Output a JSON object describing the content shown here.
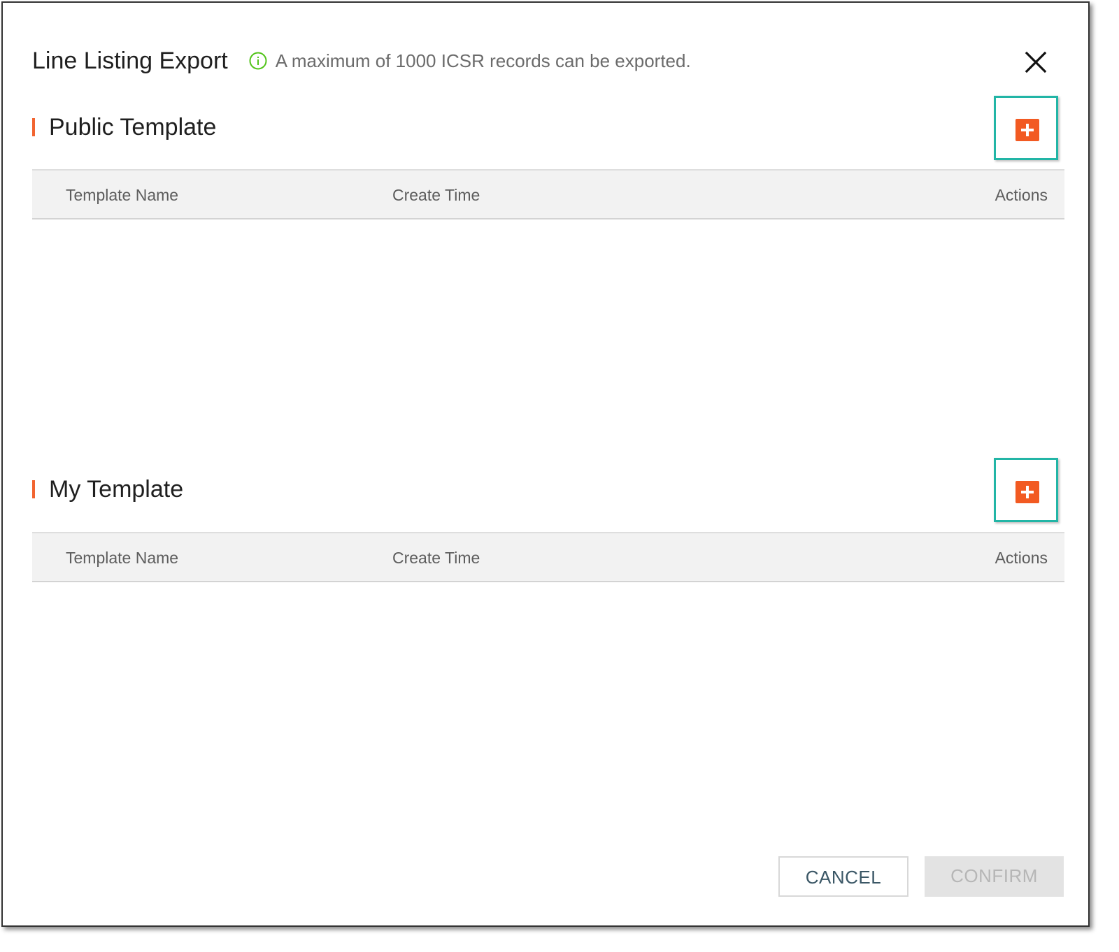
{
  "dialog": {
    "title": "Line Listing Export",
    "notice": "A maximum of 1000 ICSR records can be exported.",
    "notice_icon": "info-circle-icon",
    "close_icon": "close-icon"
  },
  "sections": [
    {
      "title": "Public Template",
      "add_icon": "plus-icon",
      "columns": [
        "Template Name",
        "Create Time",
        "Actions"
      ],
      "rows": []
    },
    {
      "title": "My Template",
      "add_icon": "plus-icon",
      "columns": [
        "Template Name",
        "Create Time",
        "Actions"
      ],
      "rows": []
    }
  ],
  "footer": {
    "cancel_label": "CANCEL",
    "confirm_label": "CONFIRM",
    "confirm_disabled": true
  },
  "colors": {
    "accent": "#f25a22",
    "highlight": "#22b5a6",
    "notice_icon": "#52c41a"
  }
}
